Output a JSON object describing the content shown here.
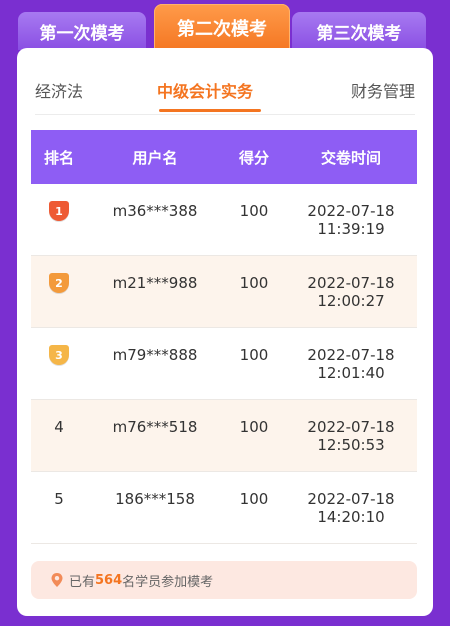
{
  "exam_tabs": [
    {
      "label": "第一次模考",
      "active": false
    },
    {
      "label": "第二次模考",
      "active": true
    },
    {
      "label": "第三次模考",
      "active": false
    }
  ],
  "subject_tabs": [
    {
      "label": "经济法",
      "active": false
    },
    {
      "label": "中级会计实务",
      "active": true
    },
    {
      "label": "财务管理",
      "active": false
    }
  ],
  "table": {
    "headers": [
      "排名",
      "用户名",
      "得分",
      "交卷时间"
    ],
    "rows": [
      {
        "rank": "1",
        "medal": "red-badge-icon",
        "medal_color": "#ee5a34",
        "user": "m36***388",
        "score": "100",
        "date": "2022-07-18",
        "time": "11:39:19"
      },
      {
        "rank": "2",
        "medal": "orange-badge-icon",
        "medal_color": "#f39a3b",
        "user": "m21***988",
        "score": "100",
        "date": "2022-07-18",
        "time": "12:00:27"
      },
      {
        "rank": "3",
        "medal": "yellow-badge-icon",
        "medal_color": "#f5b648",
        "user": "m79***888",
        "score": "100",
        "date": "2022-07-18",
        "time": "12:01:40"
      },
      {
        "rank": "4",
        "user": "m76***518",
        "score": "100",
        "date": "2022-07-18",
        "time": "12:50:53"
      },
      {
        "rank": "5",
        "user": "186***158",
        "score": "100",
        "date": "2022-07-18",
        "time": "14:20:10"
      }
    ]
  },
  "footer": {
    "prefix": "已有",
    "count": "564",
    "suffix": "名学员参加模考",
    "icon": "location-pin-icon"
  },
  "colors": {
    "background": "#7a2fd0",
    "accent": "#f47521",
    "header": "#8e5df4",
    "alt_row": "#fdf4ec"
  }
}
